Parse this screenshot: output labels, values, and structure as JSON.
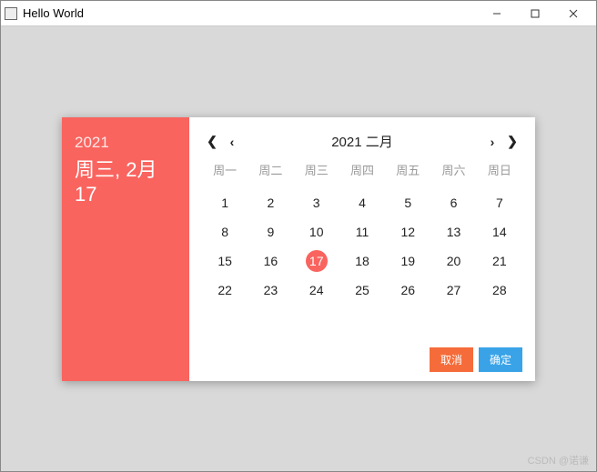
{
  "window": {
    "title": "Hello World"
  },
  "dialog": {
    "left": {
      "year": "2021",
      "date_line1": "周三, 2月",
      "date_line2": "17"
    },
    "calendar": {
      "header_title": "2021 二月",
      "dow": [
        "周一",
        "周二",
        "周三",
        "周四",
        "周五",
        "周六",
        "周日"
      ],
      "days": [
        1,
        2,
        3,
        4,
        5,
        6,
        7,
        8,
        9,
        10,
        11,
        12,
        13,
        14,
        15,
        16,
        17,
        18,
        19,
        20,
        21,
        22,
        23,
        24,
        25,
        26,
        27,
        28
      ],
      "selected": 17
    },
    "actions": {
      "cancel": "取消",
      "ok": "确定"
    }
  },
  "watermark": "CSDN @诺谦"
}
